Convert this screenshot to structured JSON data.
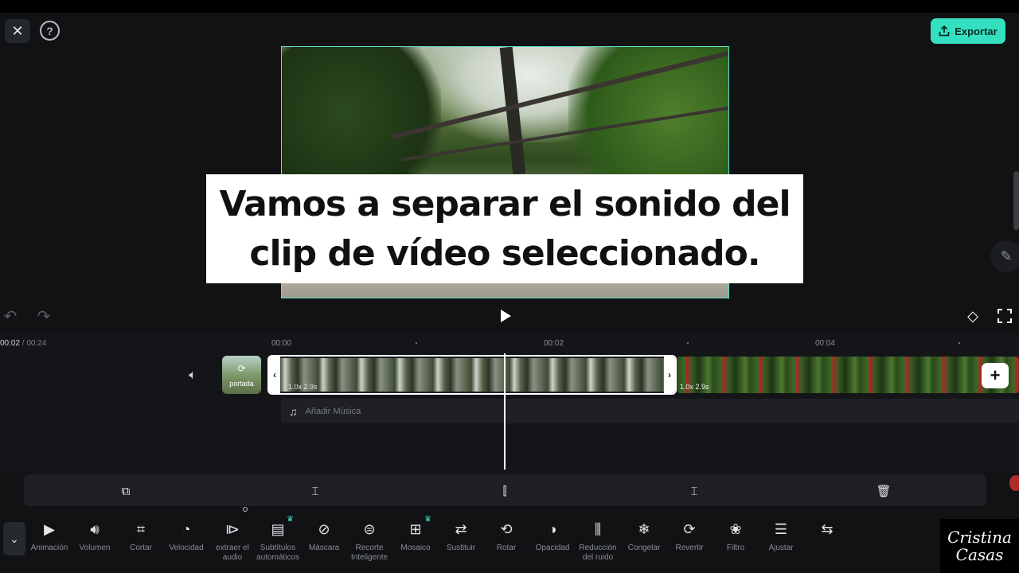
{
  "header": {
    "close_icon": "close-icon",
    "help_label": "?",
    "export_label": "Exportar",
    "accent": "#33e0c0"
  },
  "preview": {
    "caption_line1": "Vamos a separar el sonido del",
    "caption_line2": "clip de vídeo seleccionado."
  },
  "playback": {
    "current_time": "00:02",
    "total_time": " / 00:24"
  },
  "ruler": {
    "marks": [
      "00:00",
      "00:02",
      "00:04"
    ]
  },
  "timeline": {
    "cover_label": "portada",
    "clip1_meta": "1.0x  2.9s",
    "clip2_meta": "1.0x  2.9s",
    "add_music_label": "Añadir Música",
    "add_clip_label": "+"
  },
  "toolbar": {
    "tools": [
      {
        "label": "Animación",
        "icon": "animation-icon"
      },
      {
        "label": "Volumen",
        "icon": "volume-icon"
      },
      {
        "label": "Cortar",
        "icon": "crop-icon"
      },
      {
        "label": "Velocidad",
        "icon": "speed-icon"
      },
      {
        "label": "extraer el audio",
        "icon": "extract-audio-icon"
      },
      {
        "label": "Subtítulos automáticos",
        "icon": "auto-subtitles-icon"
      },
      {
        "label": "Máscara",
        "icon": "mask-icon"
      },
      {
        "label": "Recorte Inteligente",
        "icon": "smart-cutout-icon"
      },
      {
        "label": "Mosaico",
        "icon": "mosaic-icon"
      },
      {
        "label": "Sustituir",
        "icon": "replace-icon"
      },
      {
        "label": "Rotar",
        "icon": "rotate-icon"
      },
      {
        "label": "Opacidad",
        "icon": "opacity-icon"
      },
      {
        "label": "Reducción del ruido",
        "icon": "noise-reduction-icon"
      },
      {
        "label": "Congelar",
        "icon": "freeze-icon"
      },
      {
        "label": "Revertir",
        "icon": "reverse-icon"
      },
      {
        "label": "Filtro",
        "icon": "filter-icon"
      },
      {
        "label": "Ajustar",
        "icon": "adjust-icon"
      },
      {
        "label": "",
        "icon": "loop-icon"
      }
    ]
  },
  "watermark": {
    "line1": "Cristina",
    "line2": "Casas"
  }
}
